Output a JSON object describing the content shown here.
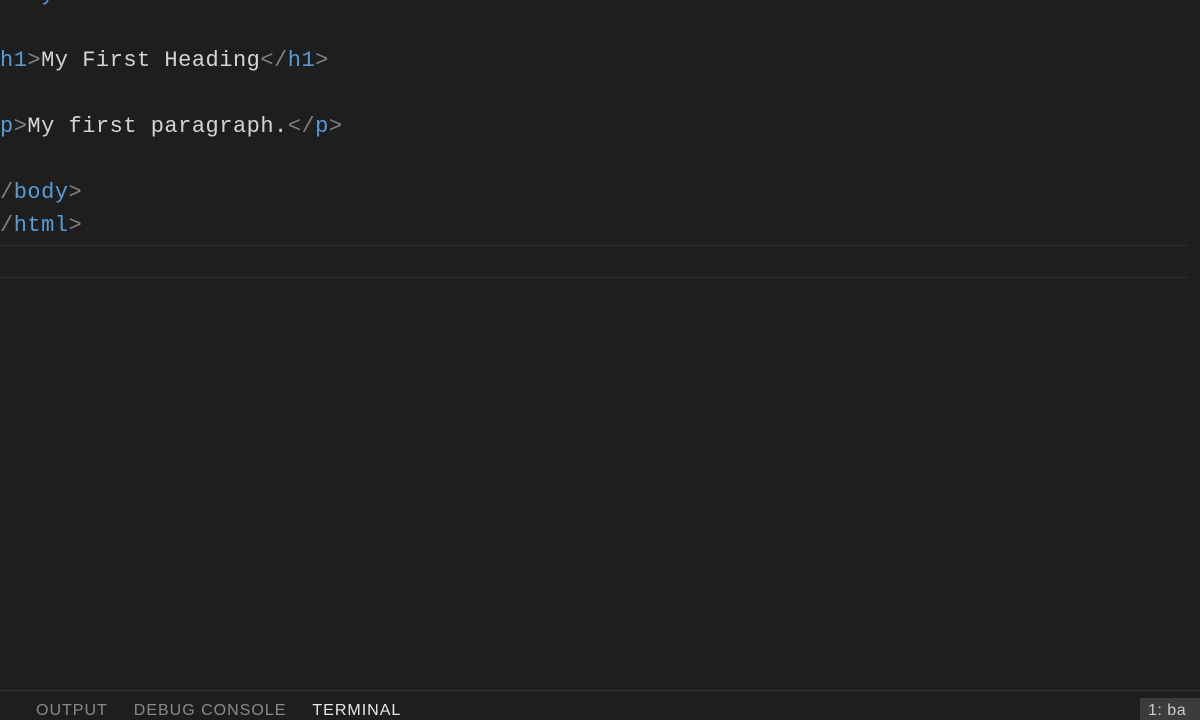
{
  "editor": {
    "lines": [
      {
        "type": "tag-open-cut",
        "name": "body"
      },
      {
        "type": "blank"
      },
      {
        "type": "element",
        "open_cut": "h1",
        "text": "My First Heading",
        "close": "h1"
      },
      {
        "type": "blank"
      },
      {
        "type": "element",
        "open_cut": "p",
        "text": "My first paragraph.",
        "close": "p"
      },
      {
        "type": "blank"
      },
      {
        "type": "tag-close-cut",
        "name": "body"
      },
      {
        "type": "tag-close-cut",
        "name": "html"
      }
    ]
  },
  "panel": {
    "tabs": {
      "output": "OUTPUT",
      "debug_console": "DEBUG CONSOLE",
      "terminal": "TERMINAL"
    },
    "active_tab": "terminal",
    "selector_label": "1: ba"
  }
}
